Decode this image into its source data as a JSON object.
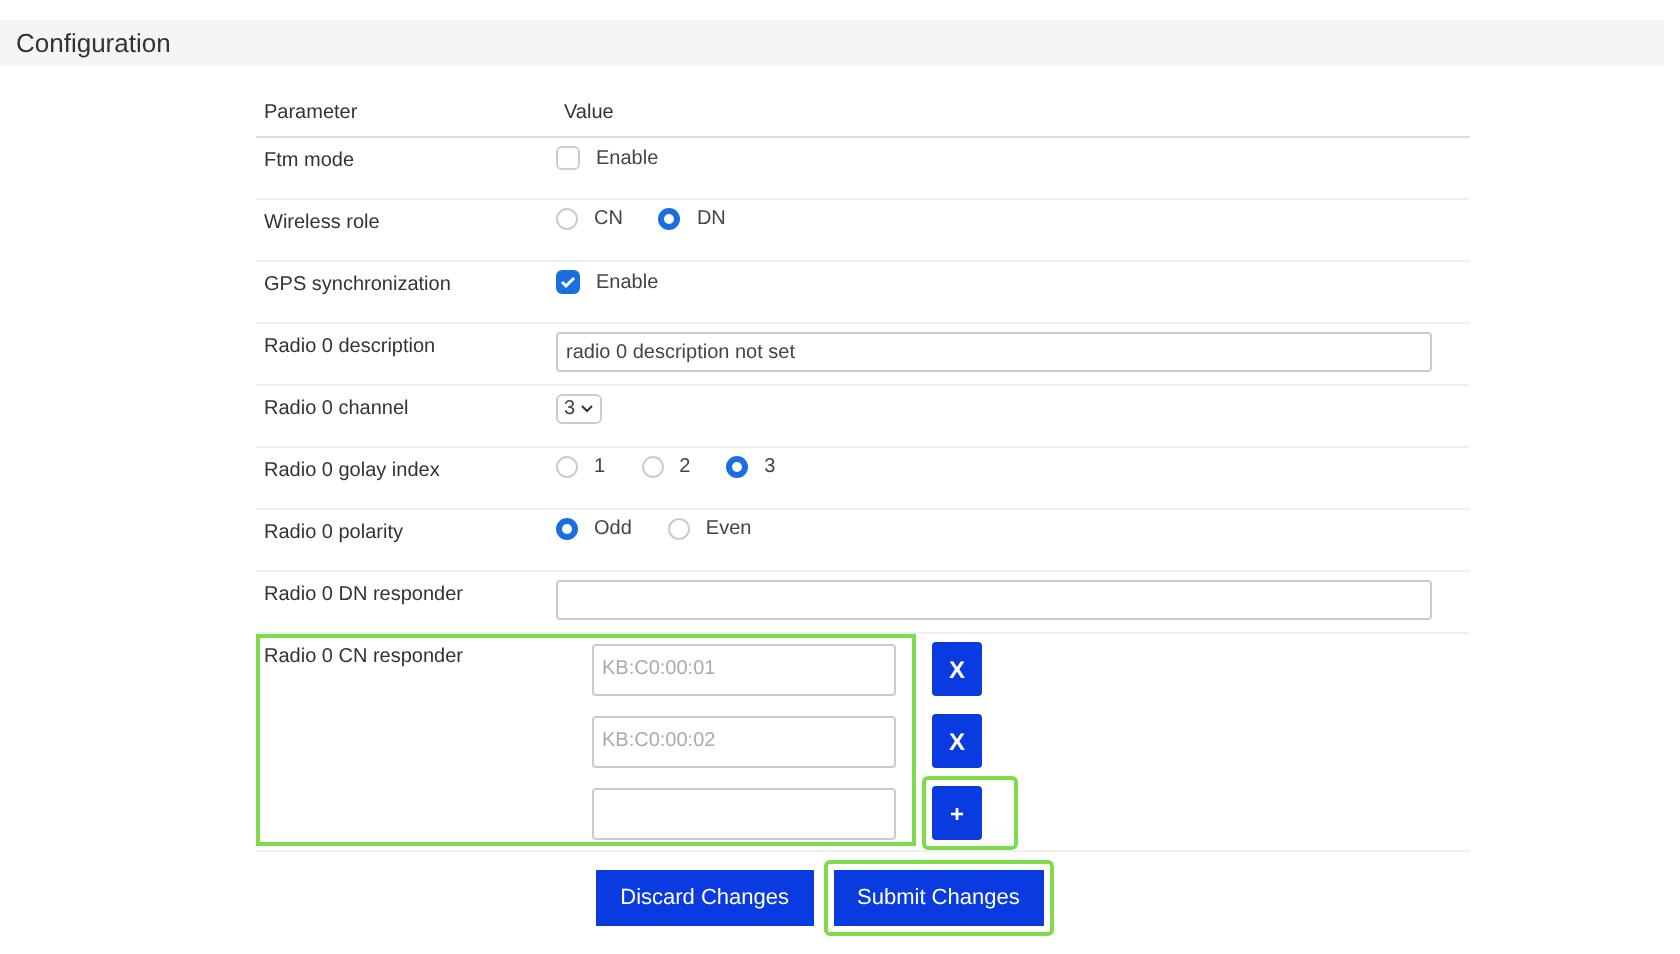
{
  "section_title": "Configuration",
  "table": {
    "columns": [
      "Parameter",
      "Value"
    ],
    "rows": [
      {
        "label": "Ftm mode",
        "kind": "checkbox",
        "option": "Enable",
        "checked": false
      },
      {
        "label": "Wireless role",
        "kind": "radio",
        "options": [
          {
            "label": "CN",
            "selected": false
          },
          {
            "label": "DN",
            "selected": true
          }
        ]
      },
      {
        "label": "GPS synchronization",
        "kind": "checkbox",
        "option": "Enable",
        "checked": true
      },
      {
        "label": "Radio 0 description",
        "kind": "text",
        "value": "radio 0 description not set"
      },
      {
        "label": "Radio 0 channel",
        "kind": "select",
        "value": "3"
      },
      {
        "label": "Radio 0 golay index",
        "kind": "radio",
        "options": [
          {
            "label": "1",
            "selected": false
          },
          {
            "label": "2",
            "selected": false
          },
          {
            "label": "3",
            "selected": true
          }
        ]
      },
      {
        "label": "Radio 0 polarity",
        "kind": "radio",
        "options": [
          {
            "label": "Odd",
            "selected": true
          },
          {
            "label": "Even",
            "selected": false
          }
        ]
      },
      {
        "label": "Radio 0 DN responder",
        "kind": "text",
        "value": ""
      },
      {
        "label": "Radio 0 CN responder",
        "kind": "list",
        "highlighted": true,
        "entries": [
          {
            "placeholder": "KB:C0:00:01",
            "action": "X"
          },
          {
            "placeholder": "KB:C0:00:02",
            "action": "X"
          },
          {
            "action": "+",
            "highlighted": true
          }
        ]
      }
    ]
  },
  "buttons": [
    {
      "label": "Discard Changes",
      "highlighted": false
    },
    {
      "label": "Submit Changes",
      "highlighted": true
    }
  ]
}
